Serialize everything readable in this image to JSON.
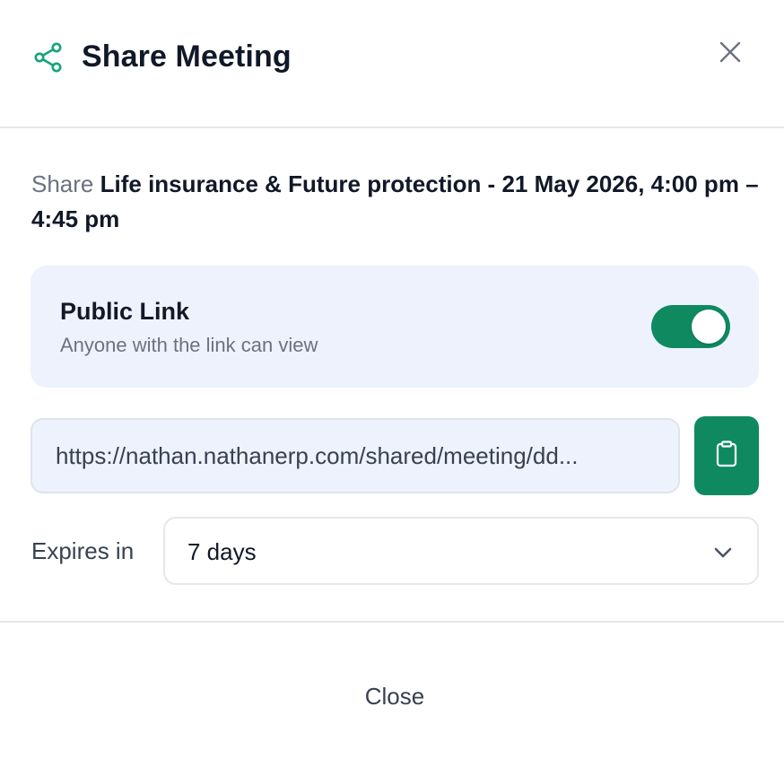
{
  "header": {
    "title": "Share Meeting",
    "share_icon": "share-icon",
    "close_icon": "close-icon"
  },
  "description": {
    "prefix": "Share",
    "meeting": "Life insurance & Future protection - 21 May 2026, 4:00 pm – 4:45 pm"
  },
  "public_link": {
    "title": "Public Link",
    "subtitle": "Anyone with the link can view",
    "enabled": true
  },
  "link": {
    "value": "https://nathan.nathanerp.com/shared/meeting/dd...",
    "copy_icon": "clipboard-icon"
  },
  "expires": {
    "label": "Expires in",
    "selected": "7 days",
    "chevron_icon": "chevron-down-icon"
  },
  "footer": {
    "close_label": "Close"
  },
  "colors": {
    "accent": "#0f8a60",
    "card_bg": "#eef2fc",
    "muted_text": "#6b7280",
    "divider": "#e5e7eb"
  }
}
